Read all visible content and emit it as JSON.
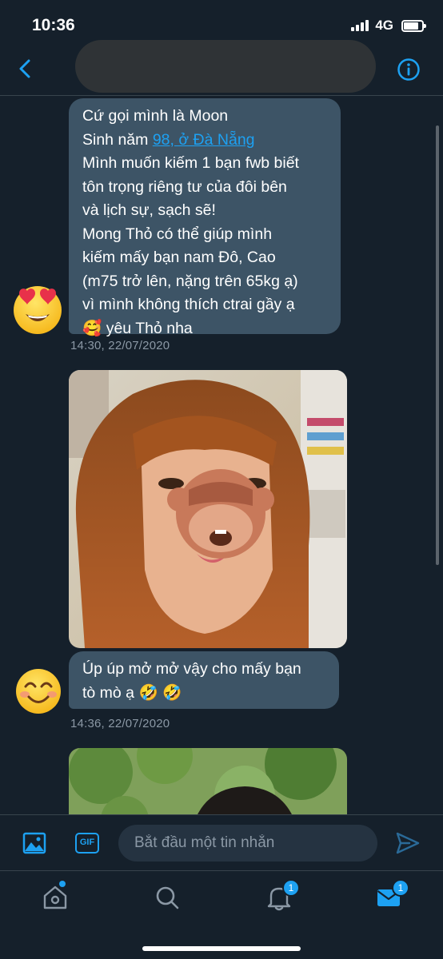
{
  "status_bar": {
    "time": "10:36",
    "network": "4G"
  },
  "header": {
    "back_icon": "chevron-left-icon",
    "info_icon": "info-icon",
    "accent_color": "#1da1f2"
  },
  "messages": [
    {
      "lines": [
        "Cứ gọi mình là Moon",
        "Mình muốn kiếm 1 bạn fwb biết",
        "tôn trọng riêng tư của đôi bên",
        "và lịch sự, sạch sẽ!",
        "Mong Thỏ có thể giúp mình",
        "kiếm mấy bạn nam Đô, Cao",
        "(m75 trở lên, nặng trên 65kg ạ)",
        "vì mình không thích ctrai gầy ạ",
        "🥰 yêu Thỏ nha"
      ],
      "line2_prefix": "Sinh năm ",
      "line2_link": "98, ở Đà Nẵng",
      "timestamp": "14:30, 22/07/2020",
      "avatar_icon": "heart-eyes-emoji-icon"
    },
    {
      "type": "photo",
      "photo_icon": "photo-with-monkey-emoji-icon"
    },
    {
      "lines": [
        "Úp úp mở mở vậy cho mấy bạn",
        "tò mò ạ 🤣 🤣"
      ],
      "timestamp": "14:36, 22/07/2020",
      "avatar_icon": "smiling-emoji-icon"
    },
    {
      "type": "photo",
      "photo_icon": "photo-icon"
    }
  ],
  "composer": {
    "gif_label": "GIF",
    "placeholder": "Bắt đầu một tin nhắn"
  },
  "tabbar": {
    "notifications_badge": "1",
    "messages_badge": "1"
  }
}
